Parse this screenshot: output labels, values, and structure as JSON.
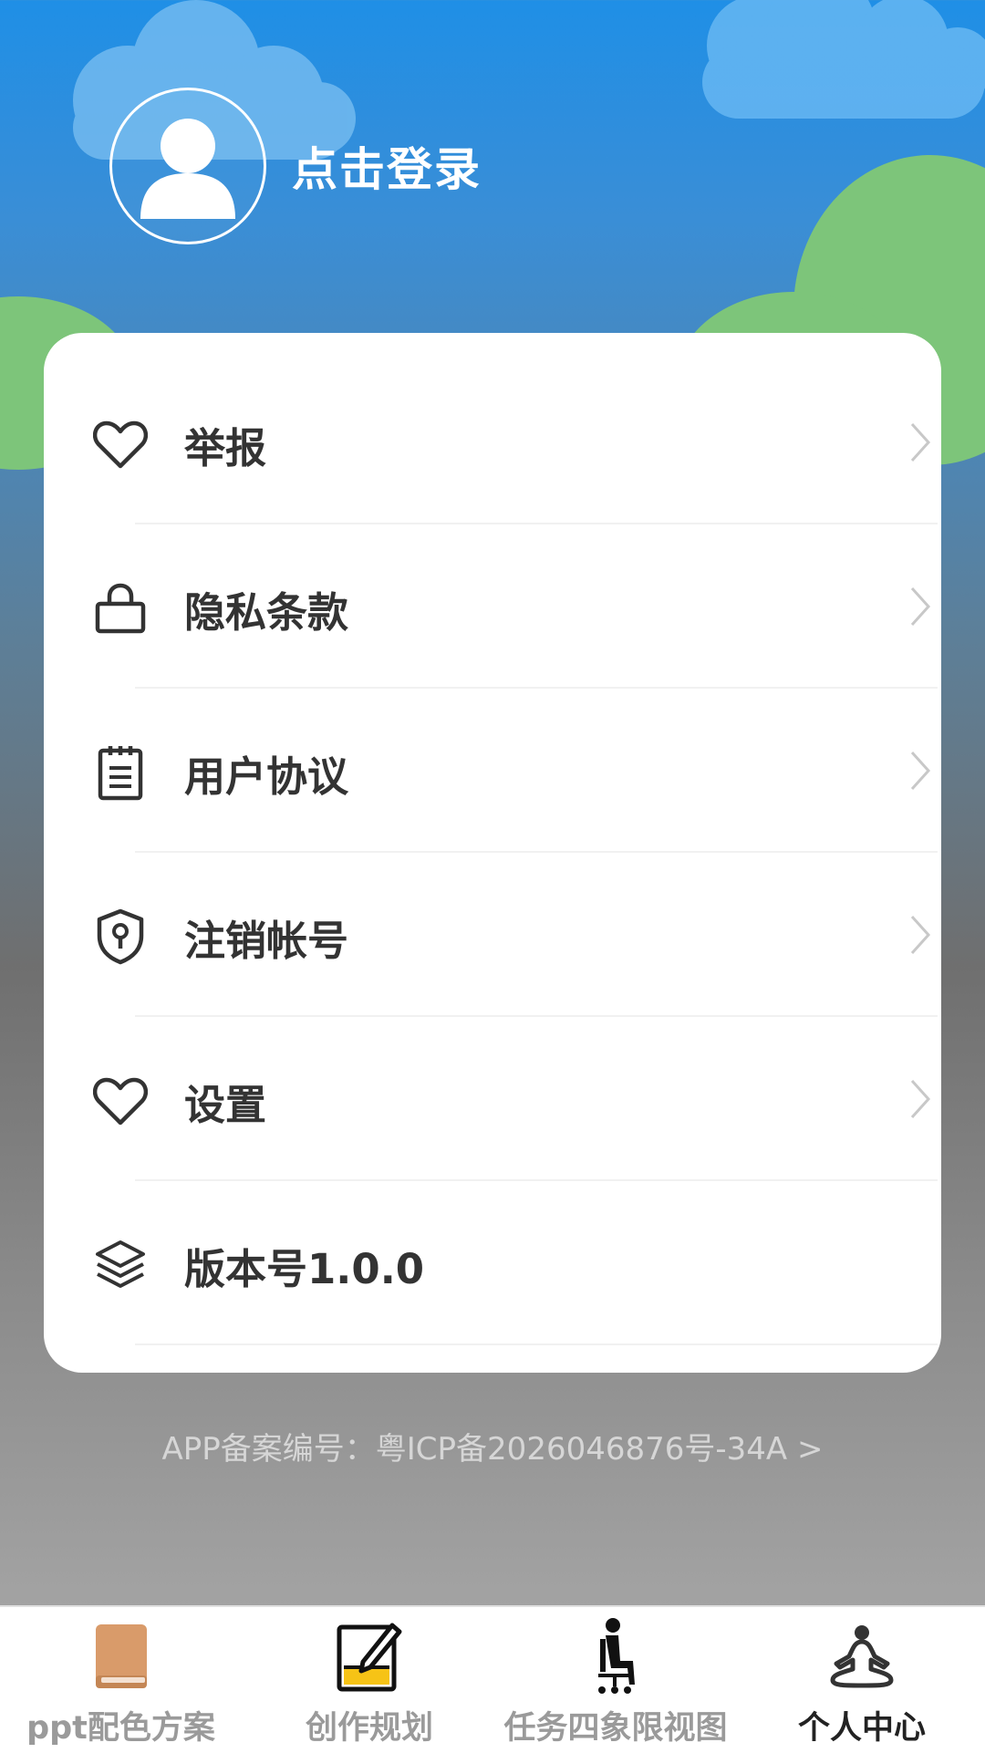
{
  "profile": {
    "login_label": "点击登录"
  },
  "menu": [
    {
      "label": "举报",
      "icon": "heart-icon"
    },
    {
      "label": "隐私条款",
      "icon": "lock-icon"
    },
    {
      "label": "用户协议",
      "icon": "document-icon"
    },
    {
      "label": "注销帐号",
      "icon": "shield-icon"
    },
    {
      "label": "设置",
      "icon": "heart-icon"
    },
    {
      "label": "版本号1.0.0",
      "icon": "layers-icon"
    }
  ],
  "footer": {
    "icp_text": "APP备案编号：粤ICP备2026046876号-34A >"
  },
  "tabs": [
    {
      "label": "ppt配色方案",
      "icon": "book-icon",
      "active": false
    },
    {
      "label": "创作规划",
      "icon": "edit-icon",
      "active": false
    },
    {
      "label": "任务四象限视图",
      "icon": "person-sitting-icon",
      "active": false
    },
    {
      "label": "个人中心",
      "icon": "meditation-icon",
      "active": true
    }
  ],
  "colors": {
    "sky_top": "#1f8fe6",
    "hills": "#7dc57a",
    "text_primary": "#333333",
    "tab_inactive": "#9a9a9a",
    "tab_active": "#222222",
    "book_accent": "#d99b6a",
    "edit_accent": "#f6c316"
  }
}
